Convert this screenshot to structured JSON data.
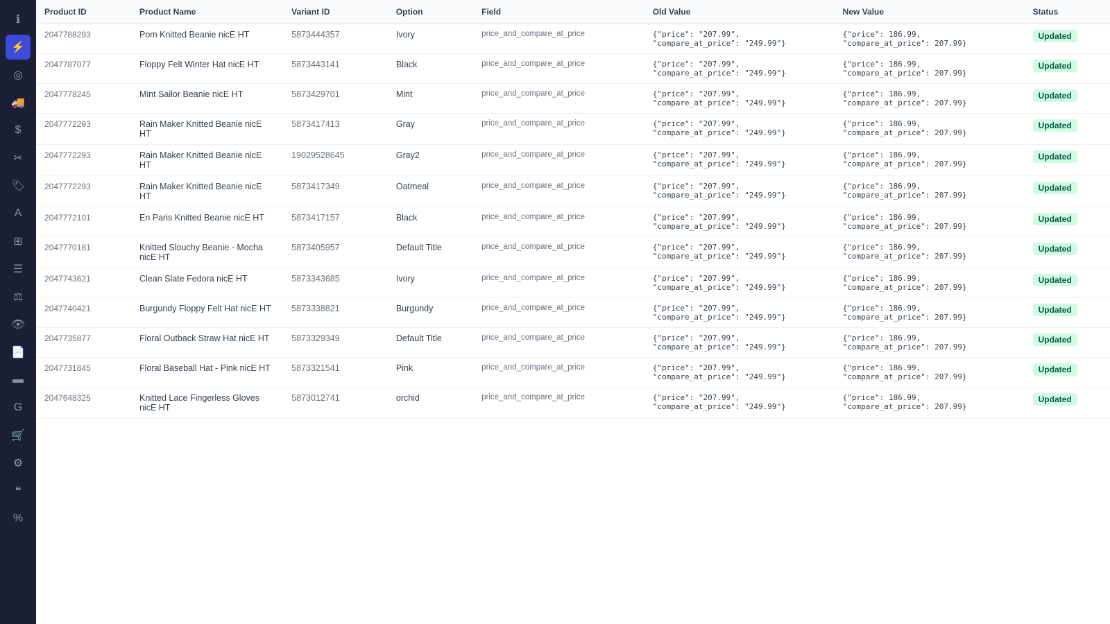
{
  "sidebar": {
    "icons": [
      {
        "name": "info-icon",
        "symbol": "ℹ",
        "active": false
      },
      {
        "name": "lightning-icon",
        "symbol": "⚡",
        "active": true
      },
      {
        "name": "circle-icon",
        "symbol": "◉",
        "active": false
      },
      {
        "name": "truck-icon",
        "symbol": "🚚",
        "active": false
      },
      {
        "name": "dollar-icon",
        "symbol": "$",
        "active": false
      },
      {
        "name": "tag-discount-icon",
        "symbol": "✂",
        "active": false
      },
      {
        "name": "label-icon",
        "symbol": "🏷",
        "active": false
      },
      {
        "name": "text-icon",
        "symbol": "A",
        "active": false
      },
      {
        "name": "grid-icon",
        "symbol": "▦",
        "active": false
      },
      {
        "name": "list-icon",
        "symbol": "☰",
        "active": false
      },
      {
        "name": "balance-icon",
        "symbol": "⚖",
        "active": false
      },
      {
        "name": "eye-icon",
        "symbol": "👁",
        "active": false
      },
      {
        "name": "doc-icon",
        "symbol": "📄",
        "active": false
      },
      {
        "name": "barcode-icon",
        "symbol": "▬",
        "active": false
      },
      {
        "name": "g-icon",
        "symbol": "G",
        "active": false
      },
      {
        "name": "cart-icon",
        "symbol": "🛒",
        "active": false
      },
      {
        "name": "settings-icon",
        "symbol": "⚙",
        "active": false
      },
      {
        "name": "quote-icon",
        "symbol": "❝",
        "active": false
      },
      {
        "name": "percent-icon",
        "symbol": "%",
        "active": false
      }
    ]
  },
  "table": {
    "columns": [
      "Product ID",
      "Product Name",
      "Variant ID",
      "Option",
      "Field",
      "Old Value",
      "New Value",
      "Status"
    ],
    "rows": [
      {
        "id": "2047788293",
        "name": "Pom Knitted Beanie nicE HT",
        "variant_id": "5873444357",
        "option": "Ivory",
        "field": "price_and_compare_at_price",
        "old_value": "{\"price\": \"207.99\", \"compare_at_price\": \"249.99\"}",
        "new_value": "{\"price\": 186.99, \"compare_at_price\": 207.99}",
        "status": "Updated"
      },
      {
        "id": "2047787077",
        "name": "Floppy Felt Winter Hat nicE HT",
        "variant_id": "5873443141",
        "option": "Black",
        "field": "price_and_compare_at_price",
        "old_value": "{\"price\": \"207.99\", \"compare_at_price\": \"249.99\"}",
        "new_value": "{\"price\": 186.99, \"compare_at_price\": 207.99}",
        "status": "Updated"
      },
      {
        "id": "2047778245",
        "name": "Mint Sailor Beanie nicE HT",
        "variant_id": "5873429701",
        "option": "Mint",
        "field": "price_and_compare_at_price",
        "old_value": "{\"price\": \"207.99\", \"compare_at_price\": \"249.99\"}",
        "new_value": "{\"price\": 186.99, \"compare_at_price\": 207.99}",
        "status": "Updated"
      },
      {
        "id": "2047772293",
        "name": "Rain Maker Knitted Beanie nicE HT",
        "variant_id": "5873417413",
        "option": "Gray",
        "field": "price_and_compare_at_price",
        "old_value": "{\"price\": \"207.99\", \"compare_at_price\": \"249.99\"}",
        "new_value": "{\"price\": 186.99, \"compare_at_price\": 207.99}",
        "status": "Updated"
      },
      {
        "id": "2047772293",
        "name": "Rain Maker Knitted Beanie nicE HT",
        "variant_id": "19029528645",
        "option": "Gray2",
        "field": "price_and_compare_at_price",
        "old_value": "{\"price\": \"207.99\", \"compare_at_price\": \"249.99\"}",
        "new_value": "{\"price\": 186.99, \"compare_at_price\": 207.99}",
        "status": "Updated"
      },
      {
        "id": "2047772293",
        "name": "Rain Maker Knitted Beanie nicE HT",
        "variant_id": "5873417349",
        "option": "Oatmeal",
        "field": "price_and_compare_at_price",
        "old_value": "{\"price\": \"207.99\", \"compare_at_price\": \"249.99\"}",
        "new_value": "{\"price\": 186.99, \"compare_at_price\": 207.99}",
        "status": "Updated"
      },
      {
        "id": "2047772101",
        "name": "En Paris Knitted Beanie nicE HT",
        "variant_id": "5873417157",
        "option": "Black",
        "field": "price_and_compare_at_price",
        "old_value": "{\"price\": \"207.99\", \"compare_at_price\": \"249.99\"}",
        "new_value": "{\"price\": 186.99, \"compare_at_price\": 207.99}",
        "status": "Updated"
      },
      {
        "id": "2047770181",
        "name": "Knitted Slouchy Beanie - Mocha nicE HT",
        "variant_id": "5873405957",
        "option": "Default Title",
        "field": "price_and_compare_at_price",
        "old_value": "{\"price\": \"207.99\", \"compare_at_price\": \"249.99\"}",
        "new_value": "{\"price\": 186.99, \"compare_at_price\": 207.99}",
        "status": "Updated"
      },
      {
        "id": "2047743621",
        "name": "Clean Slate Fedora nicE HT",
        "variant_id": "5873343685",
        "option": "Ivory",
        "field": "price_and_compare_at_price",
        "old_value": "{\"price\": \"207.99\", \"compare_at_price\": \"249.99\"}",
        "new_value": "{\"price\": 186.99, \"compare_at_price\": 207.99}",
        "status": "Updated"
      },
      {
        "id": "2047740421",
        "name": "Burgundy Floppy Felt Hat nicE HT",
        "variant_id": "5873338821",
        "option": "Burgundy",
        "field": "price_and_compare_at_price",
        "old_value": "{\"price\": \"207.99\", \"compare_at_price\": \"249.99\"}",
        "new_value": "{\"price\": 186.99, \"compare_at_price\": 207.99}",
        "status": "Updated"
      },
      {
        "id": "2047735877",
        "name": "Floral Outback Straw Hat nicE HT",
        "variant_id": "5873329349",
        "option": "Default Title",
        "field": "price_and_compare_at_price",
        "old_value": "{\"price\": \"207.99\", \"compare_at_price\": \"249.99\"}",
        "new_value": "{\"price\": 186.99, \"compare_at_price\": 207.99}",
        "status": "Updated"
      },
      {
        "id": "2047731845",
        "name": "Floral Baseball Hat - Pink nicE HT",
        "variant_id": "5873321541",
        "option": "Pink",
        "field": "price_and_compare_at_price",
        "old_value": "{\"price\": \"207.99\", \"compare_at_price\": \"249.99\"}",
        "new_value": "{\"price\": 186.99, \"compare_at_price\": 207.99}",
        "status": "Updated"
      },
      {
        "id": "2047648325",
        "name": "Knitted Lace Fingerless Gloves nicE HT",
        "variant_id": "5873012741",
        "option": "orchid",
        "field": "price_and_compare_at_price",
        "old_value": "{\"price\": \"207.99\", \"compare_at_price\": \"249.99\"}",
        "new_value": "{\"price\": 186.99, \"compare_at_price\": 207.99}",
        "status": "Updated"
      }
    ]
  }
}
